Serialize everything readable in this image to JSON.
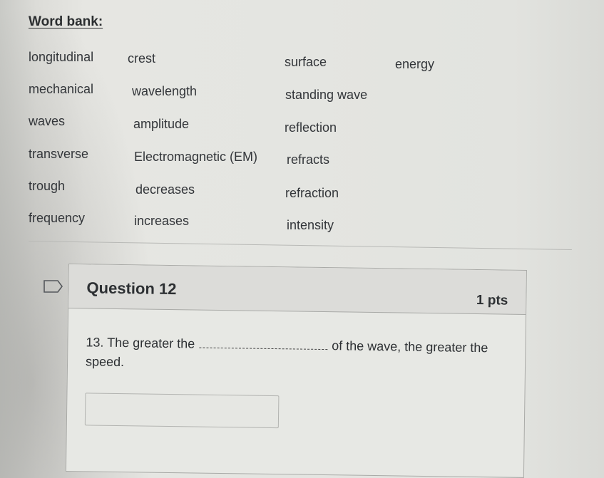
{
  "word_bank": {
    "title": "Word bank:",
    "words": [
      [
        "longitudinal",
        "crest",
        "surface",
        "energy"
      ],
      [
        "mechanical",
        "wavelength",
        "standing wave"
      ],
      [
        "waves",
        "amplitude",
        "reflection"
      ],
      [
        "transverse",
        "Electromagnetic (EM)",
        "refracts"
      ],
      [
        "trough",
        "decreases",
        "refraction"
      ],
      [
        "frequency",
        "increases",
        "intensity"
      ]
    ]
  },
  "question": {
    "flag_icon": "flag-outline-icon",
    "title": "Question 12",
    "points": "1 pts",
    "text_before": "13. The greater the",
    "text_after": "of the wave, the greater the speed.",
    "answer_value": "",
    "answer_placeholder": ""
  }
}
